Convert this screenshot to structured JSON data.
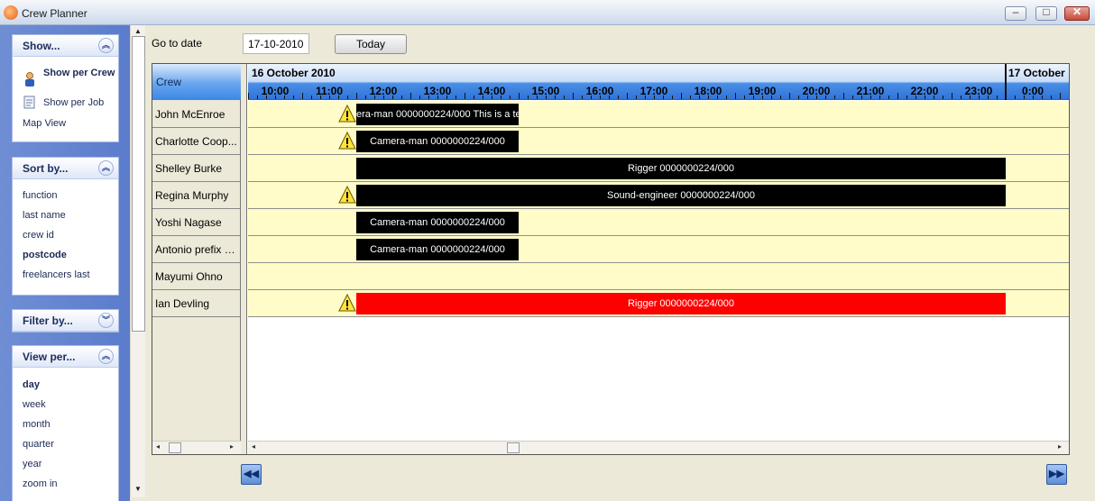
{
  "window": {
    "title": "Crew Planner",
    "min_glyph": "–",
    "max_glyph": "□",
    "close_glyph": "✕"
  },
  "sidebar": {
    "show": {
      "title": "Show...",
      "items": [
        "Show per Crew",
        "Show per Job",
        "Map View"
      ]
    },
    "sort": {
      "title": "Sort by...",
      "items": [
        "function",
        "last name",
        "crew id",
        "postcode",
        "freelancers last"
      ],
      "selected": "postcode"
    },
    "filter": {
      "title": "Filter by..."
    },
    "view": {
      "title": "View per...",
      "items": [
        "day",
        "week",
        "month",
        "quarter",
        "year",
        "zoom in"
      ],
      "selected": "day"
    }
  },
  "toolbar": {
    "goto_label": "Go to date",
    "date_value": "17-10-2010",
    "today_label": "Today"
  },
  "grid": {
    "crew_header": "Crew",
    "date1": "16 October 2010",
    "date2": "17 October",
    "hours": [
      "10:00",
      "11:00",
      "12:00",
      "13:00",
      "14:00",
      "15:00",
      "16:00",
      "17:00",
      "18:00",
      "19:00",
      "20:00",
      "21:00",
      "22:00",
      "23:00",
      "0:00"
    ],
    "crew": [
      "John McEnroe",
      "Charlotte Coop...",
      "Shelley Burke",
      "Regina Murphy",
      "Yoshi Nagase",
      "Antonio prefix d...",
      "Mayumi Ohno",
      "Ian Devling"
    ],
    "assignments": [
      {
        "label": "era-man 0000000224/000 This is a te",
        "warning": true,
        "color": "#000000"
      },
      {
        "label": "Camera-man 0000000224/000",
        "warning": true,
        "color": "#000000"
      },
      {
        "label": "Rigger 0000000224/000",
        "warning": false,
        "color": "#000000"
      },
      {
        "label": "Sound-engineer 0000000224/000",
        "warning": true,
        "color": "#000000"
      },
      {
        "label": "Camera-man 0000000224/000",
        "warning": false,
        "color": "#000000"
      },
      {
        "label": "Camera-man 0000000224/000",
        "warning": false,
        "color": "#000000"
      },
      {
        "label": "",
        "warning": false,
        "color": ""
      },
      {
        "label": "Rigger 0000000224/000",
        "warning": true,
        "color": "#ff0000"
      }
    ]
  },
  "nav": {
    "prev_glyph": "◀◀",
    "next_glyph": "▶▶"
  },
  "colors": {
    "row_background": "#fffcc9",
    "bar_default": "#000000",
    "bar_alert": "#ff0000",
    "header_blue": "#3e89e6"
  }
}
